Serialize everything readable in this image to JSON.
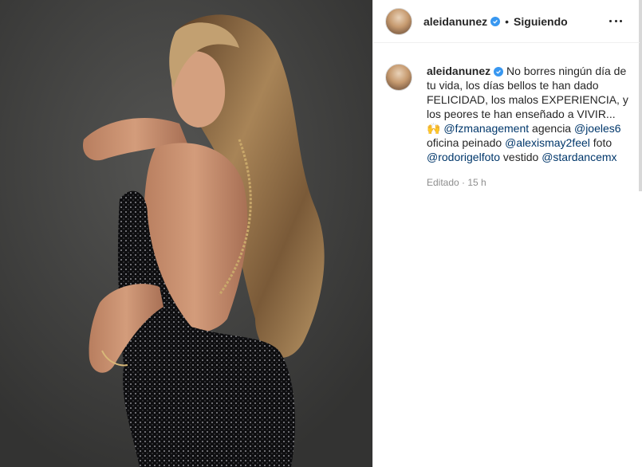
{
  "post": {
    "image_alt": "Photo of woman with long wavy hair in a black sequin backless dress",
    "colors": {
      "background": "#3e3e3d",
      "dress": "#0d0d0f",
      "hair": "#8a6a44",
      "skin": "#c48f70"
    }
  },
  "header": {
    "username": "aleidanunez",
    "separator": "•",
    "follow_status": "Siguiendo",
    "more_icon": "more-horizontal-icon"
  },
  "caption": {
    "username": "aleidanunez",
    "text_part1": " No borres ningún día de tu vida, los días bellos te han dado FELICIDAD, los malos EXPERIENCIA, y los peores te han enseñado a VIVIR...",
    "emoji": "🙌",
    "mention1": "@fzmanagement",
    "text_part2": " agencia ",
    "mention2": "@joeles6",
    "text_part3": " oficina peinado ",
    "mention3": "@alexismay2feel",
    "text_part4": " foto ",
    "mention4": "@rodorigelfoto",
    "text_part5": " vestido ",
    "mention5": "@stardancemx",
    "edited_label": "Editado",
    "time_separator": " · ",
    "time_ago": "15 h"
  },
  "accent_colors": {
    "verified": "#3897f0",
    "mention": "#00376b",
    "meta": "#8e8e8e"
  }
}
